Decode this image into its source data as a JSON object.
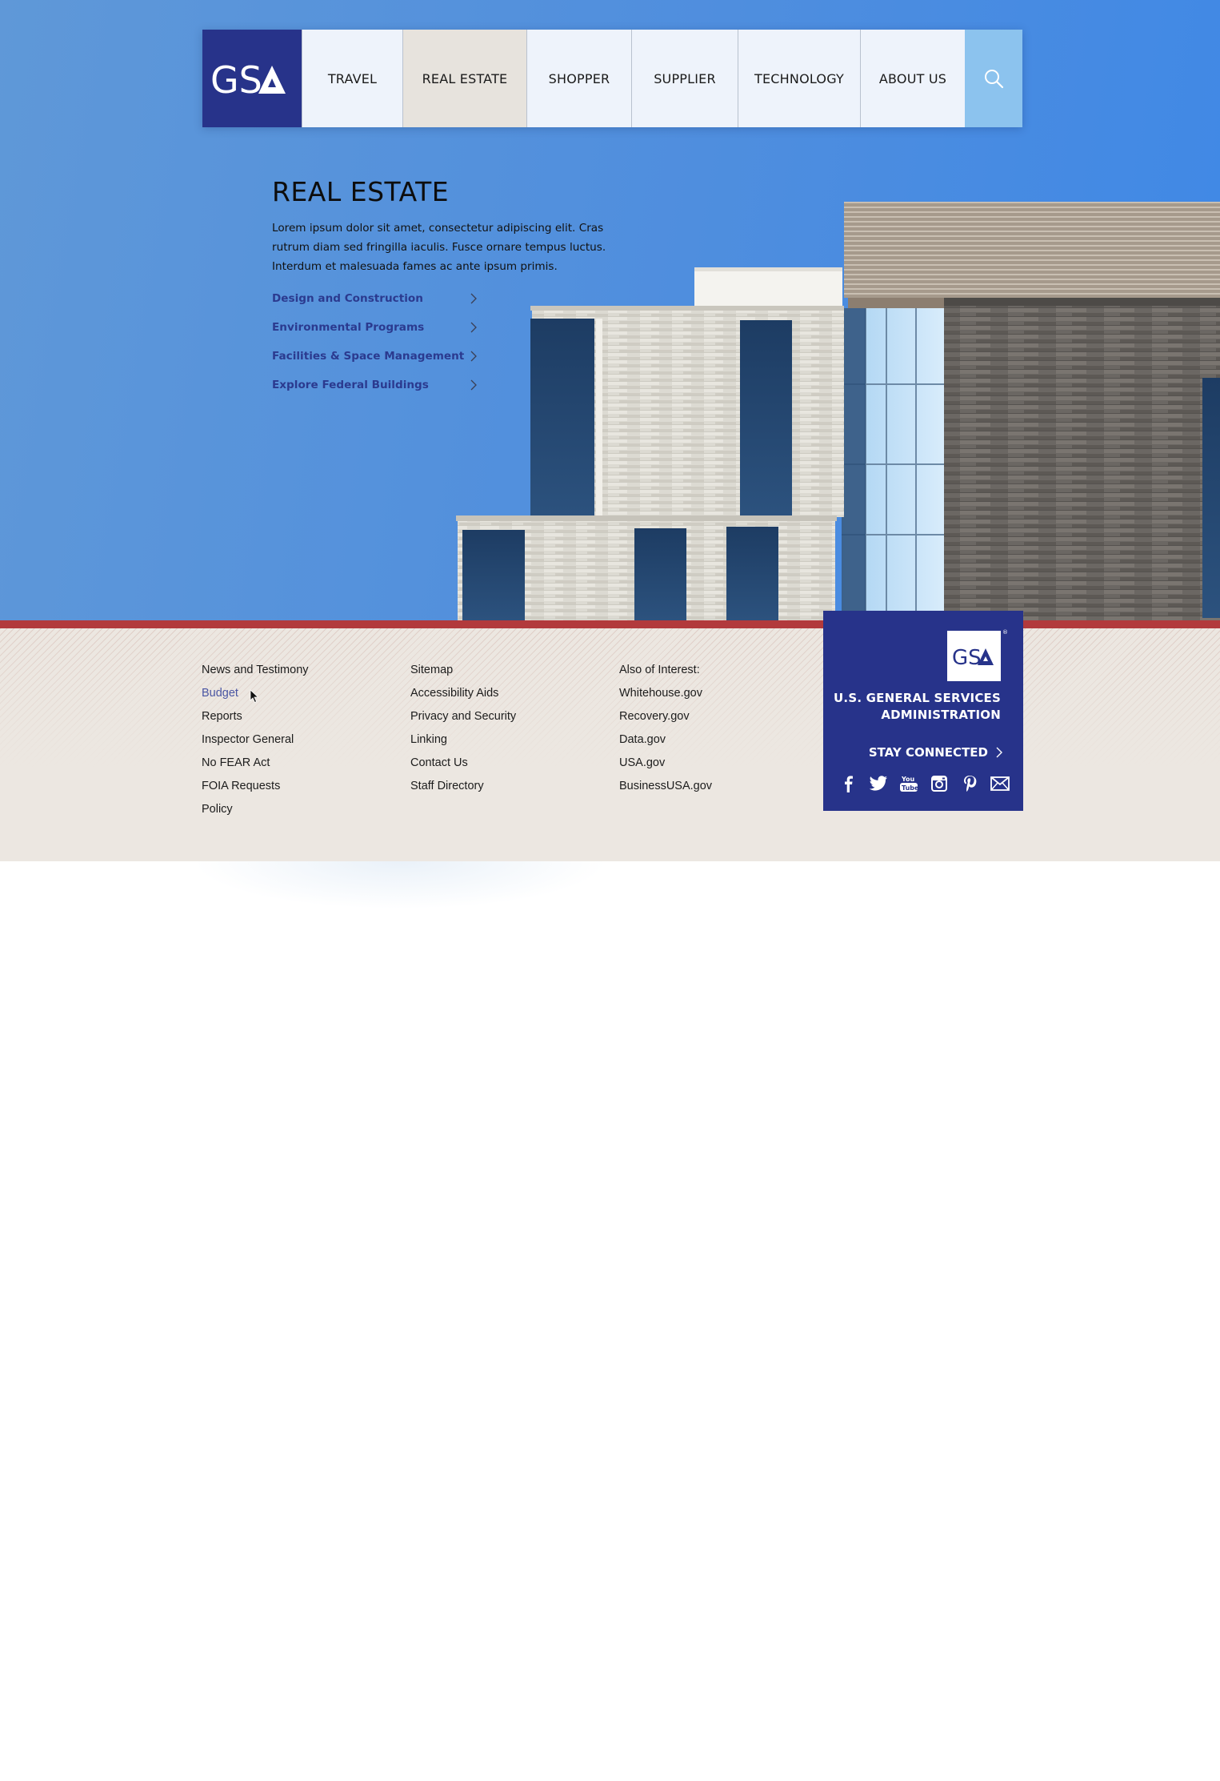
{
  "brand": {
    "logo_text": "GSA"
  },
  "nav": {
    "items": [
      {
        "label": "TRAVEL",
        "active": false
      },
      {
        "label": "REAL ESTATE",
        "active": true
      },
      {
        "label": "SHOPPER",
        "active": false
      },
      {
        "label": "SUPPLIER",
        "active": false
      },
      {
        "label": "TECHNOLOGY",
        "active": false
      },
      {
        "label": "ABOUT US",
        "active": false
      }
    ],
    "search_icon": "search-icon"
  },
  "intro": {
    "title": "REAL ESTATE",
    "body": "Lorem ipsum dolor sit amet, consectetur adipiscing elit. Cras rutrum diam sed fringilla iaculis. Fusce ornare tempus luctus. Interdum et malesuada fames ac ante ipsum primis.",
    "links": [
      "Design and Construction",
      "Environmental Programs",
      "Facilities & Space Management",
      "Explore Federal Buildings"
    ]
  },
  "footer": {
    "col1": [
      "News and Testimony",
      "Budget",
      "Reports",
      "Inspector General",
      "No FEAR Act",
      "FOIA Requests",
      "Policy"
    ],
    "col2": [
      "Sitemap",
      "Accessibility Aids",
      "Privacy and Security",
      "Linking",
      "Contact Us",
      "Staff Directory"
    ],
    "col3_heading": "Also of Interest:",
    "col3": [
      "Whitehouse.gov",
      "Recovery.gov",
      "Data.gov",
      "USA.gov",
      "BusinessUSA.gov"
    ]
  },
  "card": {
    "logo_text": "GSA",
    "agency_line1": "U.S. GENERAL SERVICES",
    "agency_line2": "ADMINISTRATION",
    "stay_connected": "STAY CONNECTED",
    "socials": [
      "facebook-icon",
      "twitter-icon",
      "youtube-icon",
      "instagram-icon",
      "pinterest-icon",
      "email-icon"
    ]
  },
  "colors": {
    "brand_blue": "#27338a",
    "accent_red": "#b23a3c",
    "link_blue": "#2b3a8f",
    "search_blue": "#8cc3ee",
    "active_tab": "#e7e3dd"
  }
}
